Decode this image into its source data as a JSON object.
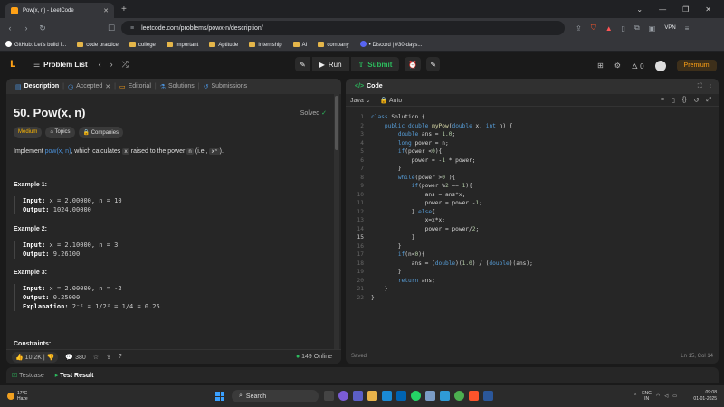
{
  "browser": {
    "tab_title": "Pow(x, n) - LeetCode",
    "url": "leetcode.com/problems/powx-n/description/",
    "vpn": "VPN",
    "bookmarks": [
      "GitHub: Let's build f...",
      "code practice",
      "college",
      "Important",
      "Aptitude",
      "Internship",
      "AI",
      "company",
      "• Discord | #30-days..."
    ]
  },
  "nav": {
    "problem_list": "Problem List",
    "run": "Run",
    "submit": "Submit",
    "streak": "0",
    "premium": "Premium"
  },
  "left": {
    "tabs": [
      "Description",
      "Accepted",
      "Editorial",
      "Solutions",
      "Submissions"
    ],
    "title": "50. Pow(x, n)",
    "solved": "Solved",
    "chips": [
      "Medium",
      "Topics",
      "Companies"
    ],
    "desc_prefix": "Implement ",
    "desc_link": "pow(x, n)",
    "desc_mid": ", which calculates ",
    "desc_x": "x",
    "desc_mid2": " raised to the power ",
    "desc_n": "n",
    "desc_suffix": " (i.e., ",
    "desc_xn": "xⁿ",
    "desc_end": ").",
    "examples": [
      {
        "h": "Example 1:",
        "input": "x = 2.00000, n = 10",
        "output": "1024.00000"
      },
      {
        "h": "Example 2:",
        "input": "x = 2.10000, n = 3",
        "output": "9.26100"
      },
      {
        "h": "Example 3:",
        "input": "x = 2.00000, n = -2",
        "output": "0.25000",
        "explanation": "2⁻² = 1/2² = 1/4 = 0.25"
      }
    ],
    "input_label": "Input:",
    "output_label": "Output:",
    "explanation_label": "Explanation:",
    "constraints": "Constraints:",
    "likes": "10.2K",
    "comments": "380",
    "online": "149 Online"
  },
  "right": {
    "title": "Code",
    "lang": "Java",
    "mode": "Auto",
    "saved": "Saved",
    "pos": "Ln 15, Col 14"
  },
  "code": [
    "class Solution {",
    "    public double myPow(double x, int n) {",
    "        double ans = 1.0;",
    "        long power = n;",
    "        if(power <0){",
    "            power = -1 * power;",
    "        }",
    "        while(power >0 ){",
    "            if(power %2 == 1){",
    "                ans = ans*x;",
    "                power = power -1;",
    "            } else{",
    "                x=x*x;",
    "                power = power/2;",
    "            }",
    "        }",
    "        if(n<0){",
    "            ans = (double)(1.0) / (double)(ans);",
    "        }",
    "        return ans;",
    "    }",
    "}"
  ],
  "bottom": {
    "testcase": "Testcase",
    "result": "Test Result"
  },
  "taskbar": {
    "temp": "17°C",
    "weather": "Haze",
    "search": "Search",
    "lang": "ENG",
    "region": "IN",
    "time": "09:08",
    "date": "01-01-2025"
  }
}
